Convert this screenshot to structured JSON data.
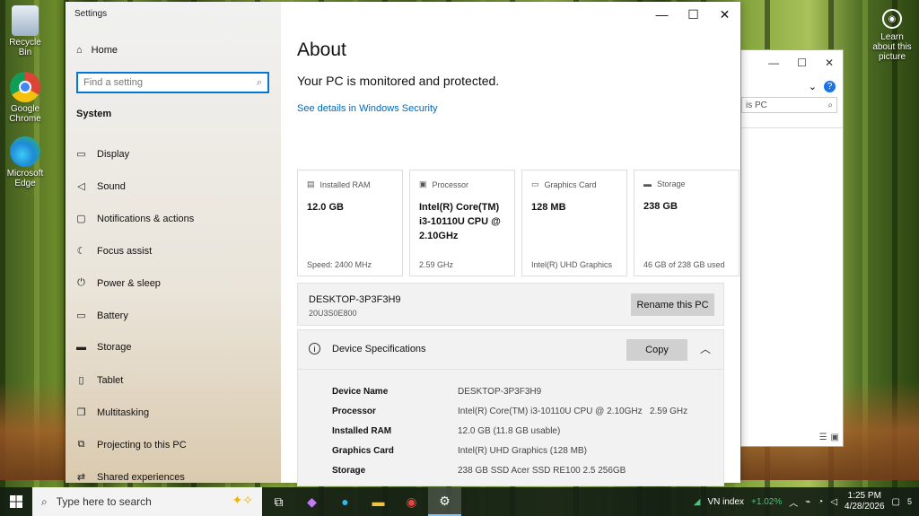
{
  "desktop": {
    "icons": [
      {
        "label": "Recycle Bin"
      },
      {
        "label": "Google Chrome"
      },
      {
        "label": "Microsoft Edge"
      }
    ],
    "lap_label": "Learn about this picture"
  },
  "explorer": {
    "search_text": "is PC"
  },
  "settings": {
    "window_title": "Settings",
    "home_label": "Home",
    "search_placeholder": "Find a setting",
    "section_title": "System",
    "nav_items": [
      {
        "label": "Display",
        "icon": "display-icon"
      },
      {
        "label": "Sound",
        "icon": "sound-icon"
      },
      {
        "label": "Notifications & actions",
        "icon": "notifications-icon"
      },
      {
        "label": "Focus assist",
        "icon": "focus-assist-icon"
      },
      {
        "label": "Power & sleep",
        "icon": "power-icon"
      },
      {
        "label": "Battery",
        "icon": "battery-icon"
      },
      {
        "label": "Storage",
        "icon": "storage-icon"
      },
      {
        "label": "Tablet",
        "icon": "tablet-icon"
      },
      {
        "label": "Multitasking",
        "icon": "multitasking-icon"
      },
      {
        "label": "Projecting to this PC",
        "icon": "projecting-icon"
      },
      {
        "label": "Shared experiences",
        "icon": "shared-icon"
      }
    ],
    "page_title": "About",
    "protection_status": "Your PC is monitored and protected.",
    "security_link": "See details in Windows Security",
    "cards": [
      {
        "label": "Installed RAM",
        "value": "12.0 GB",
        "footer": "Speed: 2400 MHz"
      },
      {
        "label": "Processor",
        "value": "Intel(R) Core(TM) i3-10110U CPU @ 2.10GHz",
        "footer": "2.59 GHz"
      },
      {
        "label": "Graphics Card",
        "value": "128 MB",
        "footer": "Intel(R) UHD Graphics"
      },
      {
        "label": "Storage",
        "value": "238 GB",
        "footer": "46 GB of 238 GB used"
      }
    ],
    "pc_name": "DESKTOP-3P3F3H9",
    "pc_model": "20U3S0E800",
    "rename_label": "Rename this PC",
    "spec_title": "Device Specifications",
    "copy_label": "Copy",
    "specs": [
      {
        "key": "Device Name",
        "value": "DESKTOP-3P3F3H9"
      },
      {
        "key": "Processor",
        "value": "Intel(R) Core(TM) i3-10110U CPU @ 2.10GHz   2.59 GHz"
      },
      {
        "key": "Installed RAM",
        "value": "12.0 GB (11.8 GB usable)"
      },
      {
        "key": "Graphics Card",
        "value": "Intel(R) UHD Graphics (128 MB)"
      },
      {
        "key": "Storage",
        "value": "238 GB SSD Acer SSD RE100 2.5 256GB"
      }
    ]
  },
  "taskbar": {
    "search_placeholder": "Type here to search",
    "stock_label": "VN index",
    "stock_change": "+1.02%",
    "time": "1:25 PM",
    "date": "4/28/2026",
    "notification_count": "5"
  }
}
